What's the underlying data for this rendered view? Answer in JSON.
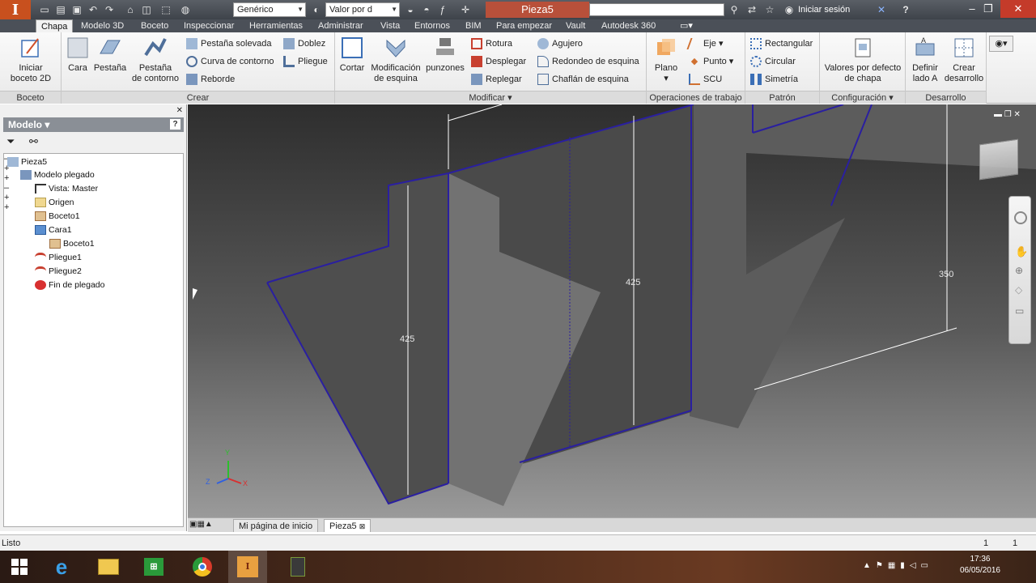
{
  "titlebar": {
    "style_combo": "Genérico",
    "value_combo": "Valor por d",
    "doc_title": "Pieza5",
    "signin": "Iniciar sesión",
    "help": "?"
  },
  "tabs": [
    "Chapa",
    "Modelo 3D",
    "Boceto",
    "Inspeccionar",
    "Herramientas",
    "Administrar",
    "Vista",
    "Entornos",
    "BIM",
    "Para empezar",
    "Vault",
    "Autodesk 360"
  ],
  "ribbon": {
    "boceto": {
      "label": "Boceto",
      "start": "Iniciar boceto 2D",
      "start_l1": "Iniciar",
      "start_l2": "boceto 2D"
    },
    "crear": {
      "label": "Crear",
      "cara": "Cara",
      "pestana": "Pestaña",
      "pestana_contorno_l1": "Pestaña",
      "pestana_contorno_l2": "de contorno",
      "pestana_solevada": "Pestaña solevada",
      "curva_contorno": "Curva de contorno",
      "reborde": "Reborde",
      "doblez": "Doblez",
      "pliegue": "Pliegue"
    },
    "modificar": {
      "label": "Modificar",
      "cortar": "Cortar",
      "mod_esquina_l1": "Modificación",
      "mod_esquina_l2": "de esquina",
      "punzones": "punzones",
      "rotura": "Rotura",
      "desplegar": "Desplegar",
      "replegar": "Replegar",
      "agujero": "Agujero",
      "redondeo": "Redondeo de esquina",
      "chaflan": "Chaflán de esquina"
    },
    "operaciones": {
      "label": "Operaciones de trabajo",
      "plano": "Plano",
      "eje": "Eje",
      "punto": "Punto",
      "scu": "SCU"
    },
    "patron": {
      "label": "Patrón",
      "rectangular": "Rectangular",
      "circular": "Circular",
      "simetria": "Simetría"
    },
    "configuracion": {
      "label": "Configuración",
      "valores_l1": "Valores por defecto",
      "valores_l2": "de chapa"
    },
    "desarrollo": {
      "label": "Desarrollo",
      "definir_l1": "Definir",
      "definir_l2": "lado A",
      "crear_l1": "Crear",
      "crear_l2": "desarrollo"
    }
  },
  "browser": {
    "title": "Modelo",
    "tree": [
      {
        "label": "Pieza5"
      },
      {
        "label": "Modelo plegado"
      },
      {
        "label": "Vista: Master"
      },
      {
        "label": "Origen"
      },
      {
        "label": "Boceto1"
      },
      {
        "label": "Cara1"
      },
      {
        "label": "Boceto1"
      },
      {
        "label": "Pliegue1"
      },
      {
        "label": "Pliegue2"
      },
      {
        "label": "Fin de plegado"
      }
    ]
  },
  "viewport": {
    "dim_left": "425",
    "dim_mid": "425",
    "dim_right": "350",
    "axis_x": "X",
    "axis_y": "Y",
    "axis_z": "Z"
  },
  "doctabs": {
    "home": "Mi página de inicio",
    "part": "Pieza5"
  },
  "status": {
    "text": "Listo",
    "n1": "1",
    "n2": "1"
  },
  "taskbar": {
    "time": "17:36",
    "date": "06/05/2016"
  },
  "colors": {
    "edge": "#2a1fa0",
    "title_accent": "#b8503a"
  }
}
